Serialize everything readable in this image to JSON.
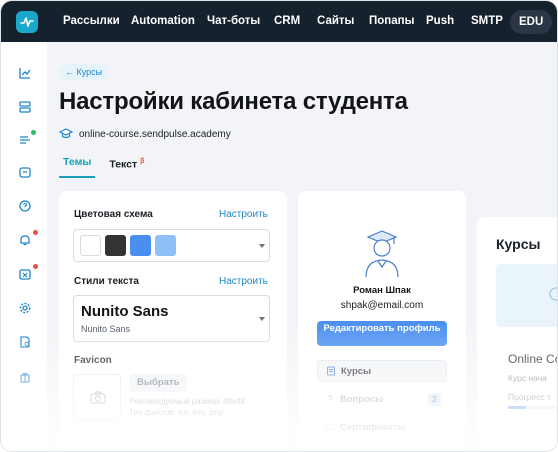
{
  "topnav": {
    "items": [
      {
        "label": "Рассылки"
      },
      {
        "label": "Automation"
      },
      {
        "label": "Чат-боты"
      },
      {
        "label": "CRM"
      },
      {
        "label": "Сайты"
      },
      {
        "label": "Попапы"
      },
      {
        "label": "Push"
      },
      {
        "label": "SMTP"
      },
      {
        "label": "EDU",
        "active": true
      }
    ]
  },
  "sidebar": {
    "icons": [
      "analytics-icon",
      "database-icon",
      "list-icon",
      "chat-icon",
      "help-icon",
      "bell-icon",
      "inbox-icon",
      "settings-icon",
      "document-icon",
      "gift-icon"
    ]
  },
  "header": {
    "back_label": "← Курсы",
    "title": "Настройки кабинета студента",
    "domain": "online-course.sendpulse.academy"
  },
  "tabs": [
    {
      "label": "Темы",
      "active": true
    },
    {
      "label": "Текст",
      "beta": "β"
    }
  ],
  "settings": {
    "color_scheme_label": "Цветовая схема",
    "color_scheme_action": "Настроить",
    "swatches": [
      "#ffffff",
      "#333333",
      "#4a8ff0",
      "#8fc0f7"
    ],
    "text_styles_label": "Стили текста",
    "text_styles_action": "Настроить",
    "font_heading": "Nunito Sans",
    "font_body": "Nunito Sans",
    "favicon_label": "Favicon",
    "favicon_button": "Выбрать",
    "favicon_hint_size": "Рекомендуемый размер: 48x48",
    "favicon_hint_types": "Тип файлов: ico, svg, png"
  },
  "profile": {
    "name": "Роман Шпак",
    "email": "shpak@email.com",
    "edit_button": "Редактировать профиль",
    "menu": [
      {
        "label": "Курсы",
        "selected": true
      },
      {
        "label": "Вопросы",
        "badge": "2"
      },
      {
        "label": "Сертификаты"
      }
    ]
  },
  "courses_preview": {
    "title": "Курсы",
    "course_name": "Online Co",
    "course_sub": "Курс нача",
    "progress_label": "Прогресс т",
    "progress": 0.35
  },
  "colors": {
    "nav_bg": "#16212e",
    "accent": "#1aa0b8",
    "primary": "#4a8ff0",
    "link": "#1e86c8",
    "alert": "#e8533f"
  }
}
